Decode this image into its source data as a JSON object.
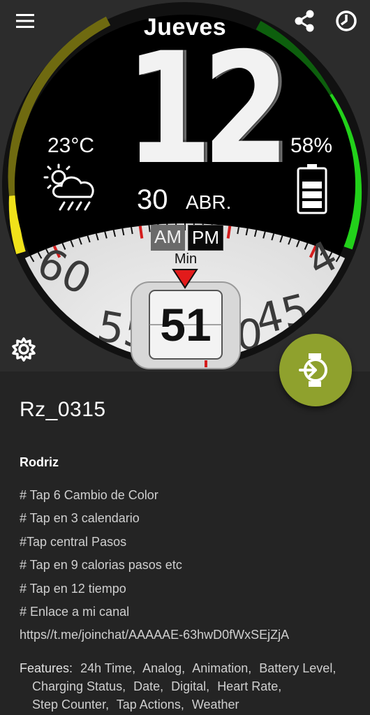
{
  "colors": {
    "accent": "#8fa12d",
    "ring_yellow": "#f0e21a",
    "ring_olive": "#6f6a10",
    "ring_dark_green": "#0d5f0d",
    "ring_green": "#22d11a",
    "tick_red": "#d41e1e"
  },
  "toolbar": {
    "menu_icon": "hamburger-menu-icon",
    "share_icon": "share-icon",
    "history_icon": "clock-history-icon",
    "settings_icon": "gear-icon"
  },
  "watch": {
    "day": "Jueves",
    "hour": "12",
    "temperature": "23°C",
    "weather_icon": "partly-cloudy-rain-icon",
    "battery_percent": "58%",
    "battery_level": 0.58,
    "date_day": "30",
    "date_month": "ABR.",
    "am": "AM",
    "pm": "PM",
    "min_label": "Min",
    "minute": "51",
    "dial_numbers": [
      "60",
      "55",
      "50",
      "45",
      "4"
    ]
  },
  "fab": {
    "icon": "watch-install-icon"
  },
  "info": {
    "title": "Rz_0315",
    "author": "Rodriz",
    "description": [
      "# Tap 6 Cambio de Color",
      "# Tap en 3 calendario",
      "#Tap central Pasos",
      "# Tap en 9 calorias pasos etc",
      "# Tap en 12 tiempo",
      "# Enlace a mi canal",
      "https//t.me/joinchat/AAAAAE-63hwD0fWxSEjZjA"
    ],
    "features_label": "Features:",
    "features": [
      "24h Time,",
      "Analog,",
      "Animation,",
      "Battery Level,",
      "Charging Status,",
      "Date,",
      "Digital,",
      "Heart Rate,",
      "Step Counter,",
      "Tap Actions,",
      "Weather"
    ]
  }
}
